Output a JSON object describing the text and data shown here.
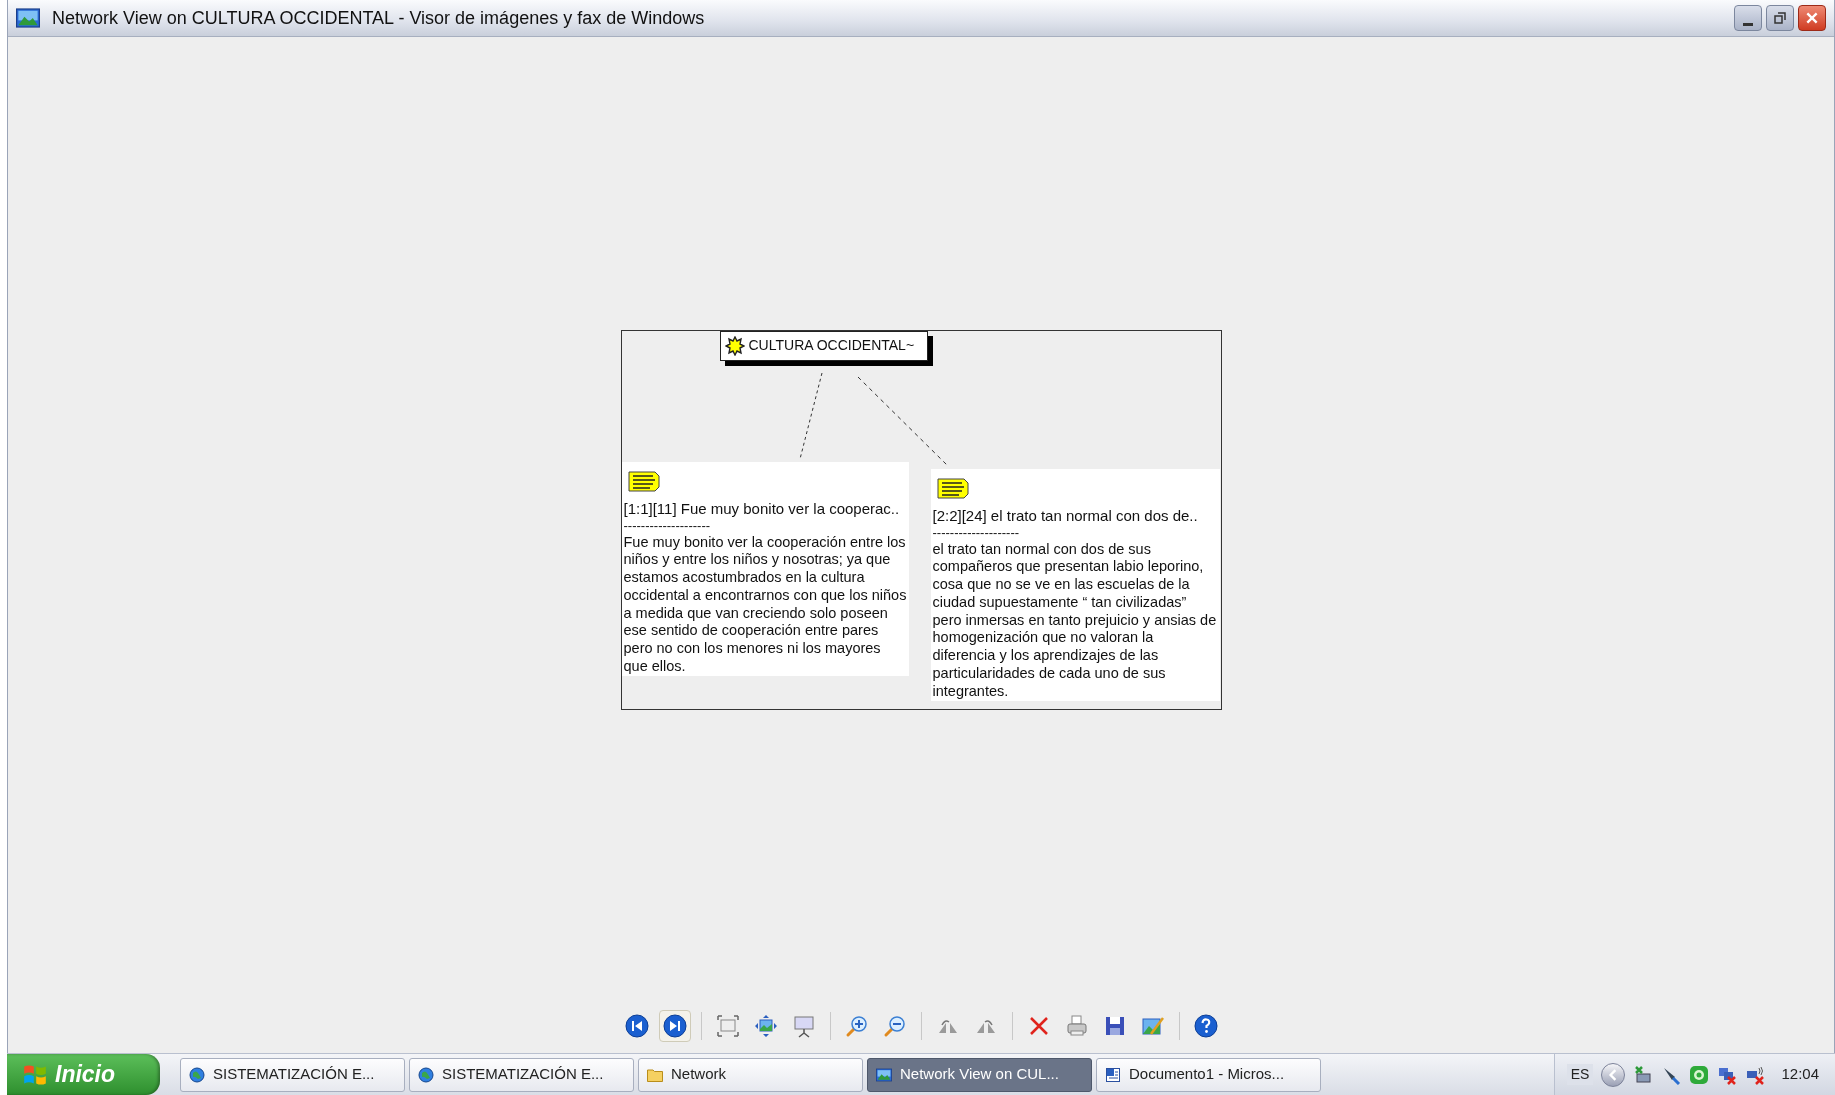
{
  "window": {
    "title": "Network View on CULTURA OCCIDENTAL - Visor de imágenes y fax de Windows"
  },
  "canvas": {
    "code_node": {
      "label": "CULTURA OCCIDENTAL~"
    },
    "notes": [
      {
        "heading": "[1:1][11] Fue muy bonito ver la cooperac..",
        "rule": "--------------------",
        "body": "Fue muy bonito ver la cooperación entre los niños y entre los niños y nosotras; ya que estamos acostumbrados en la cultura occidental a encontrarnos con que los niños a medida que van creciendo solo poseen ese sentido de cooperación entre pares pero no con los menores ni los mayores que ellos."
      },
      {
        "heading": "[2:2][24] el trato tan normal con dos de..",
        "rule": "--------------------",
        "body": "el trato tan normal con dos de sus compañeros que presentan labio leporino, cosa que no se ve en las escuelas de la ciudad supuestamente “ tan civilizadas” pero inmersas en tanto prejuicio y ansias de homogenización que no valoran la diferencia y los aprendizajes de las particularidades de cada uno de sus integrantes."
      }
    ]
  },
  "taskbar": {
    "start_label": "Inicio",
    "tasks": [
      {
        "label": "SISTEMATIZACIÓN E...",
        "kind": "browser",
        "selected": false
      },
      {
        "label": "SISTEMATIZACIÓN E...",
        "kind": "browser",
        "selected": false
      },
      {
        "label": "Network",
        "kind": "folder",
        "selected": false
      },
      {
        "label": "Network View on CUL...",
        "kind": "viewer",
        "selected": true
      },
      {
        "label": "Documento1 - Micros...",
        "kind": "document",
        "selected": false
      }
    ],
    "language": "ES",
    "clock": "12:04"
  }
}
